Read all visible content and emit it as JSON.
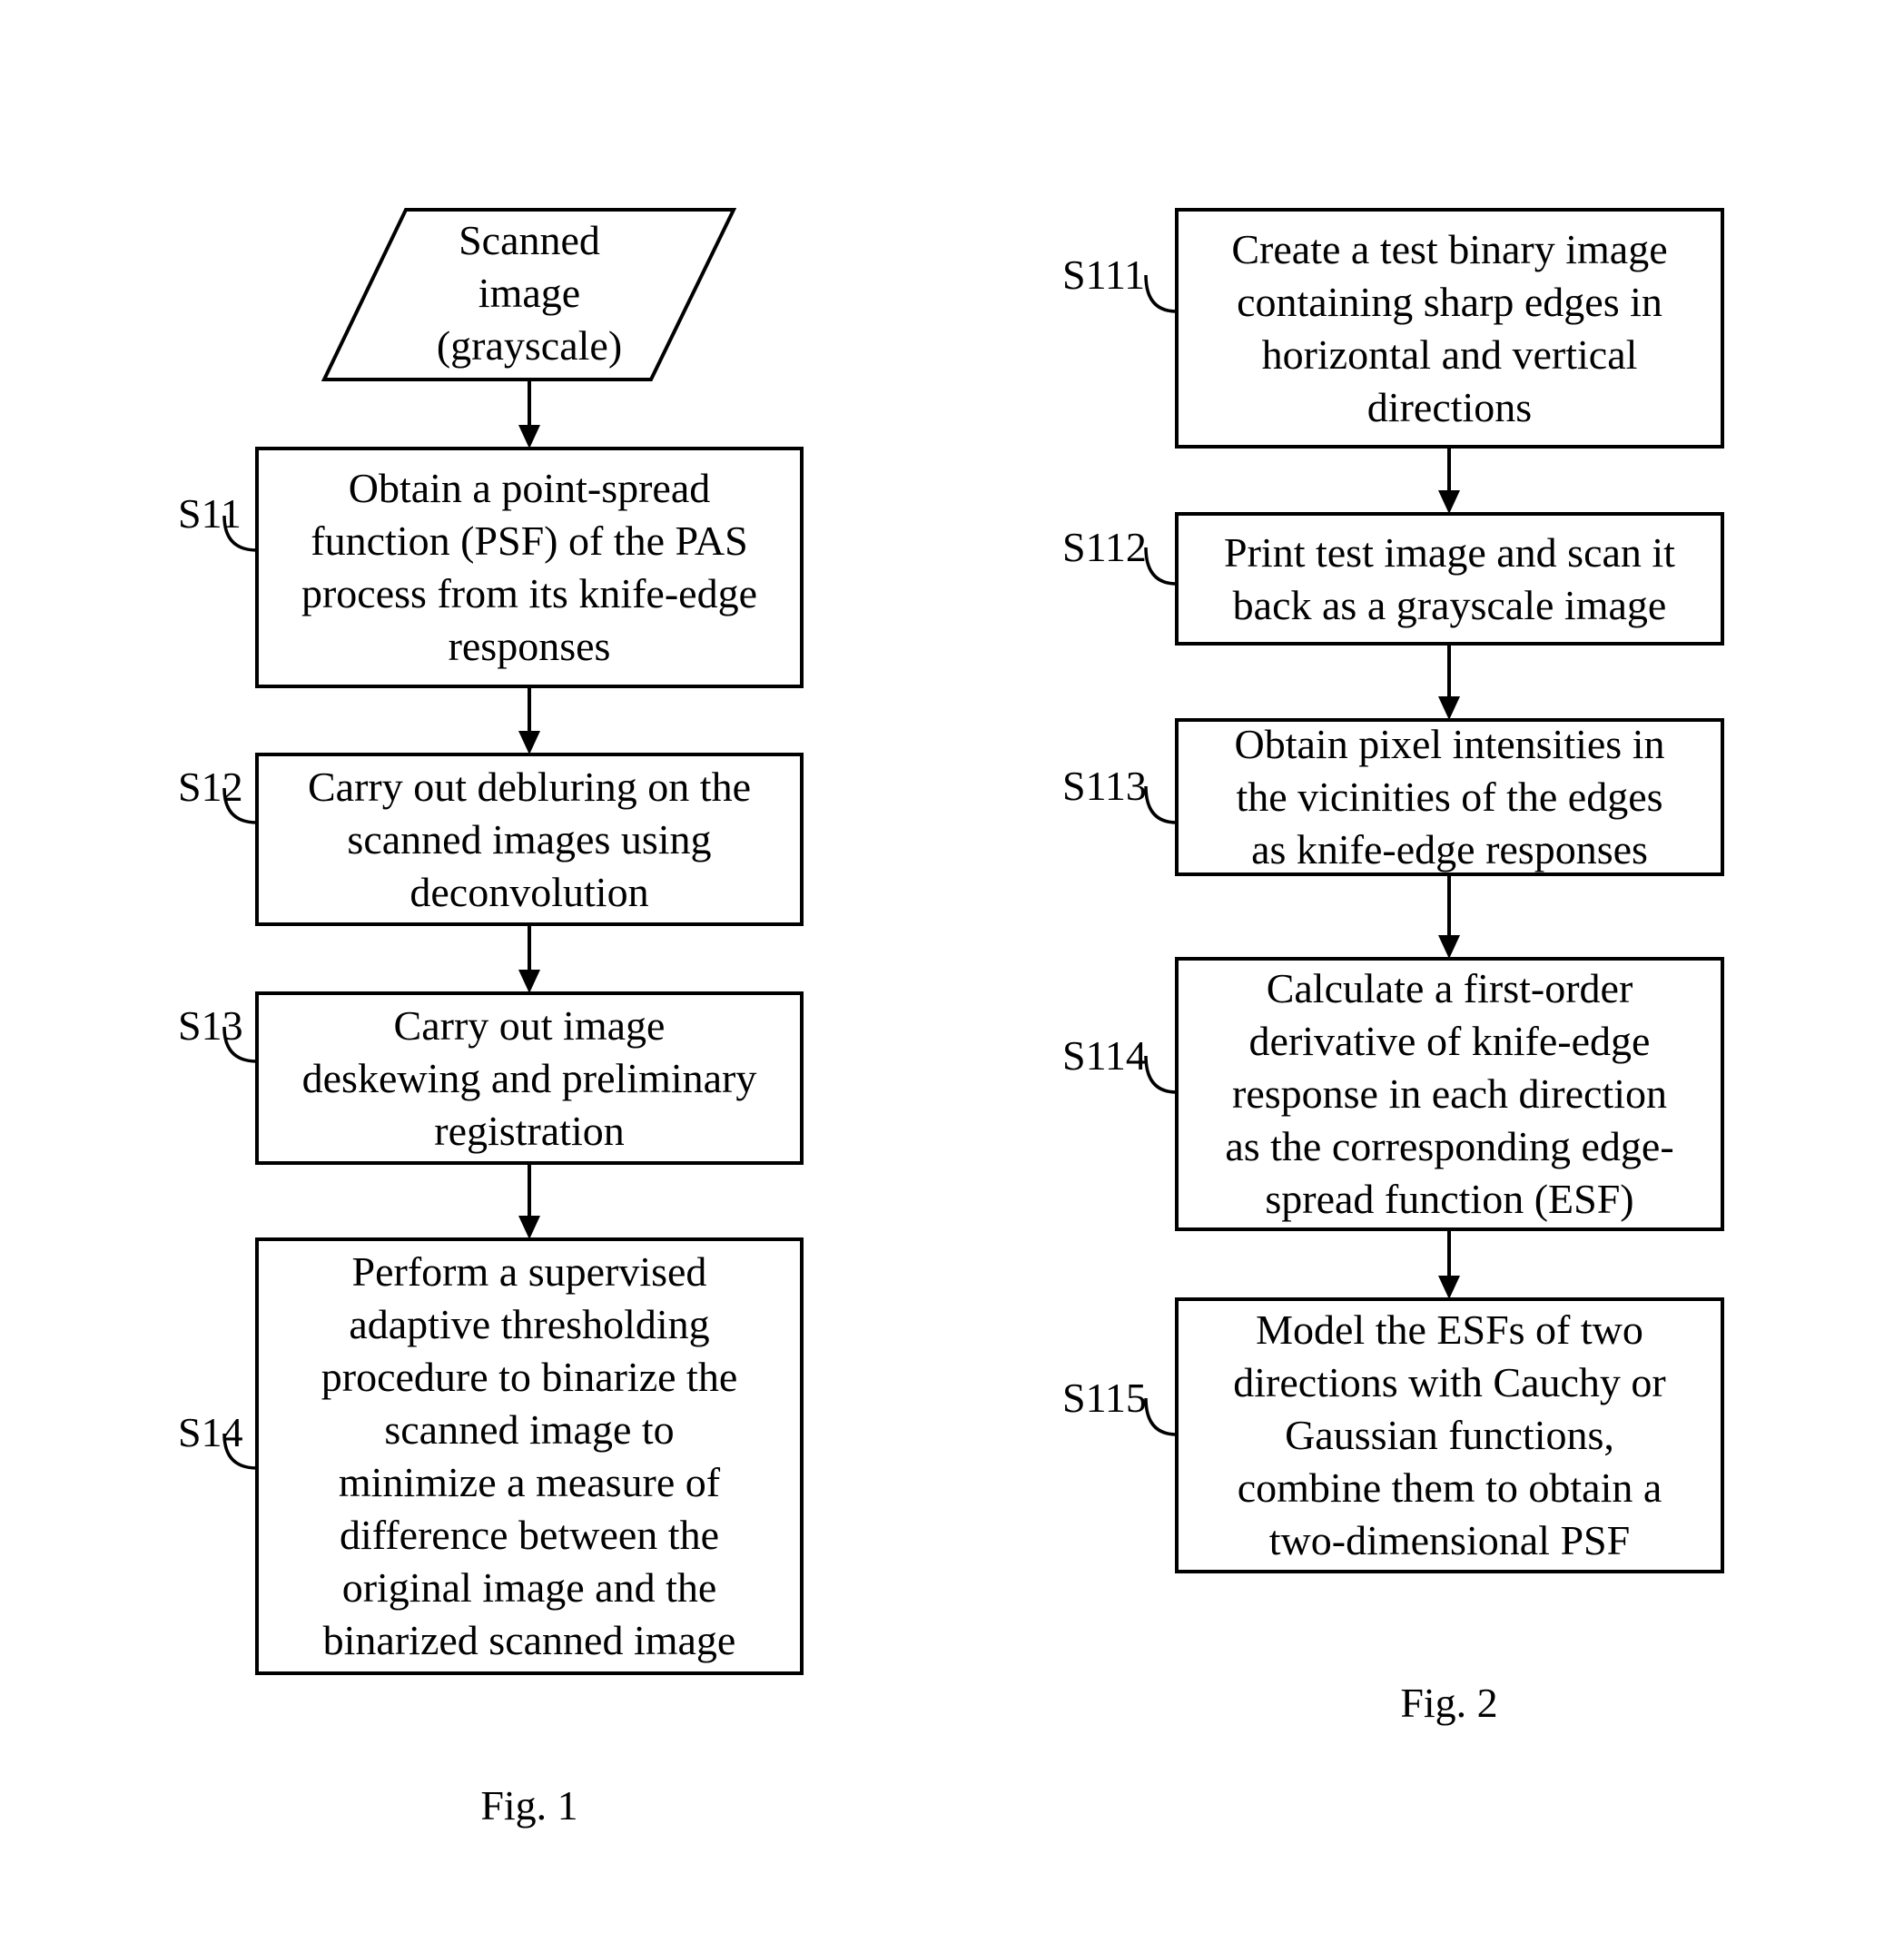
{
  "figures": [
    {
      "caption": "Fig. 1",
      "input": {
        "text_lines": [
          "Scanned",
          "image",
          "(grayscale)"
        ]
      },
      "steps": [
        {
          "id": "S11",
          "text_lines": [
            "Obtain a point-spread",
            "function (PSF) of the PAS",
            "process from its knife-edge",
            "responses"
          ]
        },
        {
          "id": "S12",
          "text_lines": [
            "Carry out debluring on the",
            "scanned images using",
            "deconvolution"
          ]
        },
        {
          "id": "S13",
          "text_lines": [
            "Carry out image",
            "deskewing and preliminary",
            "registration"
          ]
        },
        {
          "id": "S14",
          "text_lines": [
            "Perform a supervised",
            "adaptive thresholding",
            "procedure to binarize the",
            "scanned image to",
            "minimize a measure of",
            "difference between the",
            "original image and the",
            "binarized scanned image"
          ]
        }
      ]
    },
    {
      "caption": "Fig. 2",
      "steps": [
        {
          "id": "S111",
          "text_lines": [
            "Create a test binary image",
            "containing sharp edges in",
            "horizontal and vertical",
            "directions"
          ]
        },
        {
          "id": "S112",
          "text_lines": [
            "Print test image and scan it",
            "back as a grayscale image"
          ]
        },
        {
          "id": "S113",
          "text_lines": [
            "Obtain pixel intensities in",
            "the vicinities of the edges",
            "as knife-edge responses"
          ]
        },
        {
          "id": "S114",
          "text_lines": [
            "Calculate a first-order",
            "derivative of knife-edge",
            "response in each direction",
            "as the corresponding edge-",
            "spread function (ESF)"
          ]
        },
        {
          "id": "S115",
          "text_lines": [
            "Model the ESFs of two",
            "directions with Cauchy or",
            "Gaussian functions,",
            "combine them to obtain a",
            "two-dimensional PSF"
          ]
        }
      ]
    }
  ]
}
